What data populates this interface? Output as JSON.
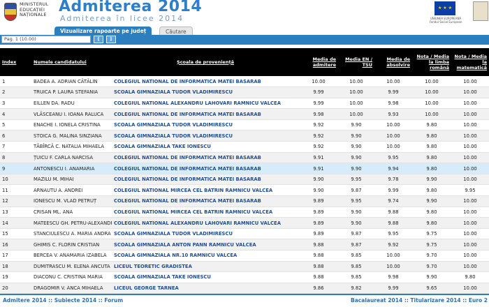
{
  "header": {
    "ministry_lines": [
      "MINISTERUL",
      "EDUCAȚIEI",
      "NAȚIONALE"
    ],
    "title": "Admiterea 2014",
    "subtitle": "Admiterea în licee 2014",
    "eu_label": "UNIUNEA EUROPEANĂ\nFondul Social European"
  },
  "tabs": [
    {
      "label": "Vizualizare rapoarte pe județ",
      "active": true
    },
    {
      "label": "Căutare",
      "active": false
    }
  ],
  "toolbar": {
    "page_select_value": "Pag. 1 (10.00)",
    "prev_icon": "⟪",
    "next_icon": "⟫"
  },
  "table": {
    "columns": [
      "Index",
      "Numele candidatului",
      "Școala de proveniență",
      "Media de admitere",
      "Media EN / TSU",
      "Media de absolvire",
      "Nota / Media la limba română",
      "Nota / Media la matematică"
    ],
    "rows": [
      [
        "1",
        "BADEA A. ADRIAN CĂTĂLIN",
        "COLEGIUL NATIONAL DE INFORMATICA MATEI BASARAB",
        "10.00",
        "10.00",
        "10.00",
        "10.00",
        "10.00"
      ],
      [
        "2",
        "TRUICA P. LAURA STEFANIA",
        "SCOALA GIMNAZIALA TUDOR VLADIMIRESCU",
        "9.99",
        "10.00",
        "9.99",
        "10.00",
        "10.00"
      ],
      [
        "3",
        "EILLEN DA. RADU",
        "COLEGIUL NATIONAL ALEXANDRU LAHOVARI RAMNICU VALCEA",
        "9.99",
        "10.00",
        "9.98",
        "10.00",
        "10.00"
      ],
      [
        "4",
        "VLĂSCEANU I. IOANA RALUCA",
        "COLEGIUL NATIONAL DE INFORMATICA MATEI BASARAB",
        "9.98",
        "10.00",
        "9.93",
        "10.00",
        "10.00"
      ],
      [
        "5",
        "ENACHE I. IONELA CRISTINA",
        "SCOALA GIMNAZIALA TUDOR VLADIMIRESCU",
        "9.92",
        "9.90",
        "10.00",
        "9.80",
        "10.00"
      ],
      [
        "6",
        "STOICA G. MALINA SINZIANA",
        "SCOALA GIMNAZIALA TUDOR VLADIMIRESCU",
        "9.92",
        "9.90",
        "10.00",
        "9.80",
        "10.00"
      ],
      [
        "7",
        "TĂBÎRCĂ C. NATALIA MIHAELA",
        "SCOALA GIMNAZIALA TAKE IONESCU",
        "9.92",
        "9.90",
        "10.00",
        "9.80",
        "10.00"
      ],
      [
        "8",
        "ȚUICU F. CARLA NARCISA",
        "COLEGIUL NATIONAL DE INFORMATICA MATEI BASARAB",
        "9.91",
        "9.90",
        "9.95",
        "9.80",
        "10.00"
      ],
      [
        "9",
        "ANTONESCU I. ANAMARIA",
        "COLEGIUL NATIONAL DE INFORMATICA MATEI BASARAB",
        "9.91",
        "9.90",
        "9.94",
        "9.80",
        "10.00"
      ],
      [
        "10",
        "MAZILU M. MIHAI",
        "COLEGIUL NATIONAL DE INFORMATICA MATEI BASARAB",
        "9.90",
        "9.95",
        "9.78",
        "9.90",
        "10.00"
      ],
      [
        "11",
        "ARNAUTU A. ANDREI",
        "COLEGIUL NATIONAL MIRCEA CEL BATRIN RAMNICU VALCEA",
        "9.90",
        "9.87",
        "9.99",
        "9.80",
        "9.95"
      ],
      [
        "12",
        "IONESCU M. VLAD PETRUȚ",
        "COLEGIUL NATIONAL DE INFORMATICA MATEI BASARAB",
        "9.89",
        "9.95",
        "9.74",
        "9.90",
        "10.00"
      ],
      [
        "13",
        "CRISAN ML. ANA",
        "COLEGIUL NATIONAL MIRCEA CEL BATRIN RAMNICU VALCEA",
        "9.89",
        "9.90",
        "9.88",
        "9.80",
        "10.00"
      ],
      [
        "14",
        "MATEESCU GH. PETRU-ALEXANDRU",
        "COLEGIUL NATIONAL ALEXANDRU LAHOVARI RAMNICU VALCEA",
        "9.89",
        "9.90",
        "9.88",
        "9.80",
        "10.00"
      ],
      [
        "15",
        "STANCIULESCU A. MARIA ANDRA",
        "SCOALA GIMNAZIALA TUDOR VLADIMIRESCU",
        "9.89",
        "9.87",
        "9.95",
        "9.75",
        "10.00"
      ],
      [
        "16",
        "GHIMIS C. FLORIN CRISTIAN",
        "SCOALA GIMNAZIALA ANTON PANN RAMNICU VALCEA",
        "9.88",
        "9.87",
        "9.92",
        "9.75",
        "10.00"
      ],
      [
        "17",
        "BERCEA V. ANAMARIA IZABELA",
        "SCOALA GIMNAZIALA NR.10 RAMNICU VALCEA",
        "9.88",
        "9.85",
        "10.00",
        "9.70",
        "10.00"
      ],
      [
        "18",
        "DUMITRASCU M. ELENA ANCUTA",
        "LICEUL TEORETIC GRADISTEA",
        "9.88",
        "9.85",
        "10.00",
        "9.70",
        "10.00"
      ],
      [
        "19",
        "DIACONU C. CRISTINA MARIA",
        "SCOALA GIMNAZIALA TAKE IONESCU",
        "9.88",
        "9.85",
        "9.98",
        "9.90",
        "9.80"
      ],
      [
        "20",
        "DRAGOMIR V. ANCA MIHAELA",
        "LICEUL GEORGE TARNEA",
        "9.86",
        "9.82",
        "9.99",
        "9.65",
        "10.00"
      ]
    ],
    "selected_row": 8
  },
  "footer": {
    "left": "Admitere 2014 :: Subiecte 2014 :: Forum",
    "right": "Bacalaureat 2014 :: Titularizare 2014 :: Euro 2"
  },
  "colors": {
    "accent": "#2c7fbf",
    "school_link": "#1f4e92",
    "header_bg": "#000000"
  }
}
